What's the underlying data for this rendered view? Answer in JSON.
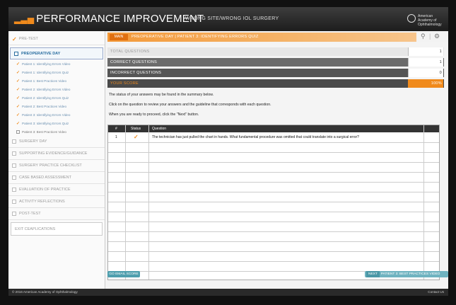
{
  "header": {
    "title": "PERFORMANCE IMPROVEMENT",
    "course": "WRONG SITE/WRONG IOL SURGERY",
    "logo_text": "American Academy of Ophthalmology"
  },
  "sidebar": {
    "pretest": "PRE-TEST",
    "active_section": "PREOPERATIVE DAY",
    "subitems": [
      {
        "label": "Patient 1: Identifying Errors Video",
        "checked": true
      },
      {
        "label": "Patient 1: Identifying Errors Quiz",
        "checked": true
      },
      {
        "label": "Patient 1: Best Practices Video",
        "checked": true
      },
      {
        "label": "Patient 2: Identifying Errors Video",
        "checked": true
      },
      {
        "label": "Patient 2: Identifying Errors Quiz",
        "checked": true
      },
      {
        "label": "Patient 2: Best Practices Video",
        "checked": true
      },
      {
        "label": "Patient 3: Identifying Errors Video",
        "checked": true
      },
      {
        "label": "Patient 3: Identifying Errors Quiz",
        "checked": true
      },
      {
        "label": "Patient 3: Best Practices Video",
        "checked": false
      }
    ],
    "sections": [
      "SURGERY DAY",
      "SUPPORTING EVIDENCE/GUIDANCE",
      "SURGERY PRACTICE CHECKLIST",
      "CASE BASED ASSESSMENT",
      "EVALUATION OF PRACTICE",
      "ACTIVITY REFLECTIONS",
      "POST-TEST"
    ],
    "exit": "EXIT CEAPLICATIONS"
  },
  "nav": {
    "main_button": "MAIN",
    "breadcrumb": "PREOPERATIVE DAY  |  PATIENT 3: IDENTIFYING ERRORS QUIZ"
  },
  "scores": {
    "total_label": "TOTAL QUESTIONS",
    "total_value": "1",
    "correct_label": "CORRECT QUESTIONS",
    "correct_value": "1",
    "incorrect_label": "INCORRECT QUESTIONS",
    "incorrect_value": "0",
    "score_label": "YOUR SCORE",
    "score_value": "100%"
  },
  "messages": {
    "line1": "The status of your answers may be found in the summary below.",
    "line2": "Click on the question to review your answers and the guideline that corresponds with each question.",
    "line3": "When you are ready to proceed, click the \"Next\" button."
  },
  "table": {
    "headers": [
      "#",
      "Status",
      "Question"
    ],
    "rows": [
      {
        "num": "1",
        "status": "✓",
        "question": "The technician has just pulled the chart in hands. What fundamental procedure was omitted that could translate into a surgical error?"
      }
    ],
    "empty_rows": 14
  },
  "buttons": {
    "email": "GO EMAIL SCORE",
    "next_tag": "NEXT",
    "next_label": "PATIENT 3: BEST PRACTICES VIDEO"
  },
  "footer": {
    "copyright": "© 2016 American Academy of Ophthalmology",
    "contact": "Contact Us"
  },
  "colors": {
    "accent": "#f08a1c",
    "link": "#2a6ea0",
    "button": "#4f9fae"
  }
}
